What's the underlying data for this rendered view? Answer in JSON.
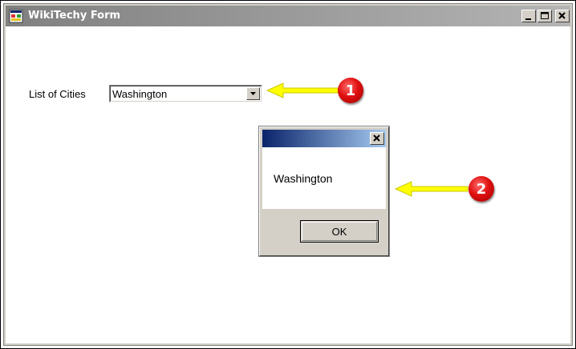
{
  "window": {
    "title": "WikiTechy Form"
  },
  "form": {
    "cities_label": "List of Cities",
    "cities_selected": "Washington"
  },
  "messagebox": {
    "message": "Washington",
    "ok_label": "OK"
  },
  "annotations": [
    {
      "number": "1"
    },
    {
      "number": "2"
    }
  ],
  "colors": {
    "arrow": "#ffff00",
    "badge": "#e01010",
    "msg_title_start": "#0a246a",
    "msg_title_end": "#a6caf0"
  },
  "icons": {
    "app": "form-app-icon",
    "minimize": "minimize-icon",
    "maximize": "maximize-icon",
    "close": "close-icon",
    "dropdown": "chevron-down-icon"
  }
}
